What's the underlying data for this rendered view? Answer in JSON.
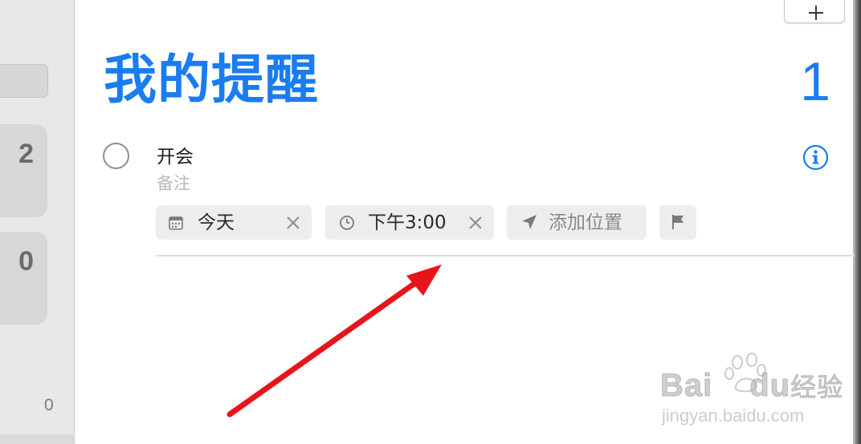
{
  "sidebar": {
    "cards": [
      {
        "count": "2"
      },
      {
        "count": "0"
      }
    ],
    "bottom_count": "0"
  },
  "header": {
    "add_button_icon": "plus-icon"
  },
  "list": {
    "title": "我的提醒",
    "count": "1",
    "accent_color": "#1a7cf0"
  },
  "reminder": {
    "title": "开会",
    "notes_placeholder": "备注",
    "info_icon": "info-icon",
    "chips": {
      "date": {
        "icon": "calendar-icon",
        "label": "今天",
        "clear_icon": "clear-icon"
      },
      "time": {
        "icon": "clock-icon",
        "label": "下午3:00",
        "clear_icon": "clear-icon"
      },
      "location": {
        "icon": "location-icon",
        "label": "添加位置"
      },
      "flag": {
        "icon": "flag-icon"
      }
    }
  },
  "annotation": {
    "type": "arrow",
    "color": "#e8141c"
  },
  "watermark": {
    "brand_latin": "Bai",
    "brand_latin_2": "du",
    "brand_cjk": "经验",
    "url": "jingyan.baidu.com"
  }
}
